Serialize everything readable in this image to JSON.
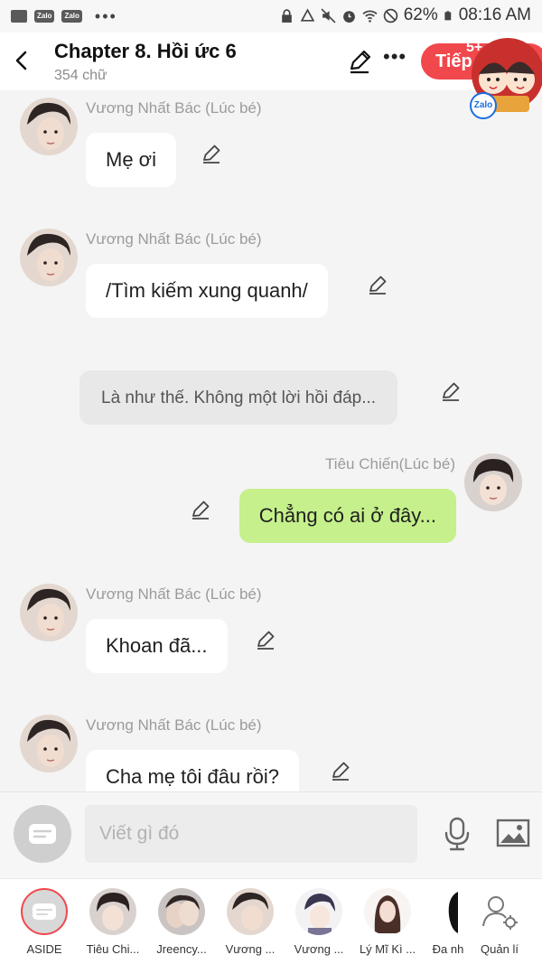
{
  "status_bar": {
    "left_apps": [
      "Zalo",
      "Zalo"
    ],
    "battery": "62%",
    "time": "08:16 AM"
  },
  "header": {
    "title": "Chapter 8. Hồi ức 6",
    "subtitle": "354 chữ",
    "next_label": "Tiếp",
    "badge": "5+",
    "sticker_label": "Zalo"
  },
  "messages": [
    {
      "sender": "Vương Nhất Bác (Lúc bé)",
      "text": "Mẹ ơi"
    },
    {
      "sender": "Vương Nhất Bác (Lúc bé)",
      "text": "/Tìm kiếm xung quanh/"
    },
    {
      "narration": "Là như thế. Không một lời hồi đáp..."
    },
    {
      "sender": "Tiêu Chiến(Lúc bé)",
      "text": "Chẳng có ai ở đây..."
    },
    {
      "sender": "Vương Nhất Bác (Lúc bé)",
      "text": "Khoan đã..."
    },
    {
      "sender": "Vương Nhất Bác (Lúc bé)",
      "text": "Cha mẹ tôi đâu rồi?"
    }
  ],
  "composer": {
    "placeholder": "Viết gì đó"
  },
  "characters": [
    {
      "label": "ASIDE"
    },
    {
      "label": "Tiêu Chi..."
    },
    {
      "label": "Jreency..."
    },
    {
      "label": "Vương ..."
    },
    {
      "label": "Vương ..."
    },
    {
      "label": "Lý Mĩ Kì ..."
    },
    {
      "label": "Đa nh"
    },
    {
      "label": "Quản lí"
    }
  ],
  "colors": {
    "accent": "#f0484d",
    "own_bubble": "#c5f08b",
    "other_bubble": "#ffffff",
    "narration_bubble": "#e8e8e8",
    "background": "#f4f4f4"
  }
}
